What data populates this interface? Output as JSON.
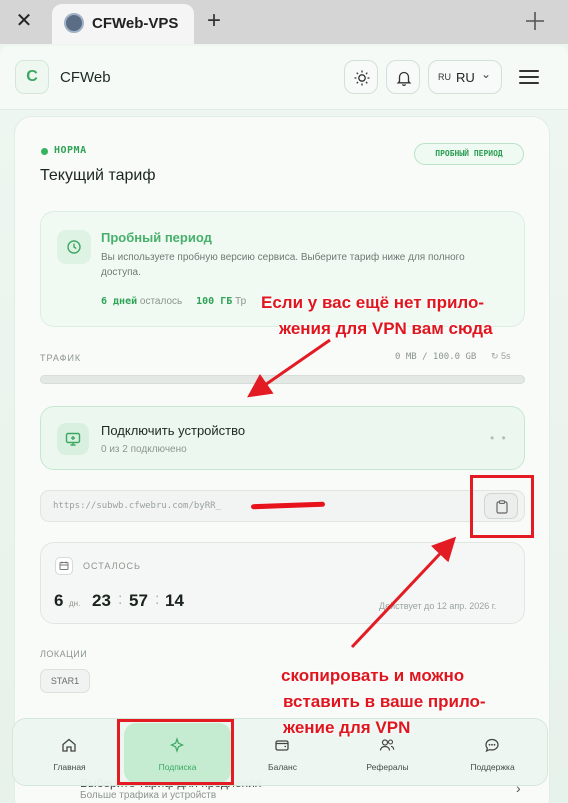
{
  "browser": {
    "close_glyph": "✕",
    "tab_title": "CFWeb-VPS",
    "new_tab_glyph": "+"
  },
  "header": {
    "logo_letter": "C",
    "brand": "CFWeb",
    "lang_code": "RU",
    "lang_value": "RU",
    "lang_chevron": "⌄"
  },
  "subscription": {
    "status": "НОРМА",
    "title": "Текущий тариф",
    "badge": "ПРОБНЫЙ ПЕРИОД",
    "plan": {
      "title": "Пробный период",
      "description": "Вы используете пробную версию сервиса. Выберите тариф ниже для полного доступа.",
      "days_value": "6 дней",
      "days_suffix": "осталось",
      "traffic_value": "100 ГБ",
      "traffic_suffix": "Тр"
    },
    "traffic": {
      "label": "ТРАФИК",
      "value": "0 MB / 100.0 GB",
      "refresh": "5s",
      "used_fraction": 0
    },
    "connect": {
      "title": "Подключить устройство",
      "subtitle": "0 из 2 подключено",
      "dots": "• •"
    },
    "url": "https://subwb.cfwebru.com/byRR_",
    "timer": {
      "label": "ОСТАЛОСЬ",
      "days": "6",
      "days_unit": "дн.",
      "hours": "23",
      "minutes": "57",
      "seconds": "14",
      "colon": ":",
      "until": "Действует до 12 апр. 2026 г."
    },
    "locations": {
      "label": "ЛОКАЦИИ",
      "items": [
        "STAR1"
      ]
    },
    "peek": {
      "title": "Выберите тариф для продления",
      "subtitle": "Больше трафика и устройств",
      "chevron": "›"
    }
  },
  "bottom_nav": [
    {
      "label": "Главная",
      "icon": "home-icon"
    },
    {
      "label": "Подписка",
      "icon": "sparkle-icon"
    },
    {
      "label": "Баланс",
      "icon": "wallet-icon"
    },
    {
      "label": "Рефералы",
      "icon": "users-icon"
    },
    {
      "label": "Поддержка",
      "icon": "chat-icon"
    }
  ],
  "annotations": {
    "top_line1": "Если у вас ещё нет прило-",
    "top_line2": "жения для VPN вам сюда",
    "bottom_line1": "скопировать и можно",
    "bottom_line2": "вставить в ваше прило-",
    "bottom_line3": "жение для VPN",
    "color": "#e31b23"
  },
  "colors": {
    "accent": "#3ca862",
    "background": "#eef6f0"
  }
}
